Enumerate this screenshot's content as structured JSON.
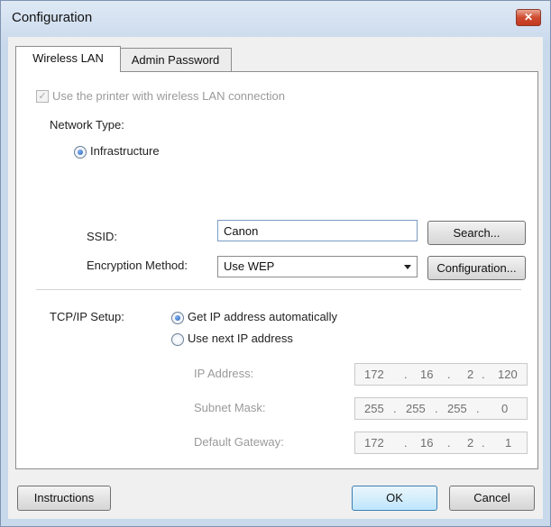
{
  "window": {
    "title": "Configuration",
    "close_glyph": "✕"
  },
  "tabs": [
    {
      "label": "Wireless LAN",
      "active": true
    },
    {
      "label": "Admin Password",
      "active": false
    }
  ],
  "wireless": {
    "use_wireless_label": "Use the printer with wireless LAN connection",
    "use_wireless_checked": true,
    "network_type_label": "Network Type:",
    "infrastructure_label": "Infrastructure",
    "ssid_label": "SSID:",
    "ssid_value": "Canon",
    "search_button": "Search...",
    "encryption_label": "Encryption Method:",
    "encryption_value": "Use WEP",
    "configuration_button": "Configuration..."
  },
  "tcpip": {
    "label": "TCP/IP Setup:",
    "auto_label": "Get IP address automatically",
    "manual_label": "Use next IP address",
    "selected": "auto",
    "ip_address_label": "IP Address:",
    "ip_address": [
      "172",
      "16",
      "2",
      "120"
    ],
    "subnet_label": "Subnet Mask:",
    "subnet": [
      "255",
      "255",
      "255",
      "0"
    ],
    "gateway_label": "Default Gateway:",
    "gateway": [
      "172",
      "16",
      "2",
      "1"
    ]
  },
  "footer": {
    "instructions_button": "Instructions",
    "ok_button": "OK",
    "cancel_button": "Cancel"
  },
  "icons": {
    "check_glyph": "✓",
    "ip_dot": "."
  },
  "colors": {
    "title_gradient": "#c9d9ec",
    "close_red": "#cf4a2f",
    "disabled_text": "#9a9a9a",
    "radio_selected": "#2a62b8",
    "default_button": "#3c7fb1"
  }
}
